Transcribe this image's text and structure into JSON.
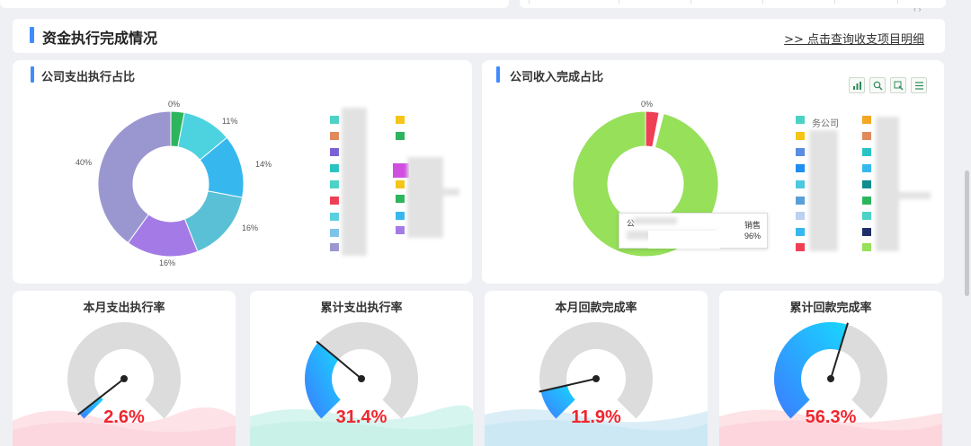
{
  "section": {
    "title": "资金执行完成情况",
    "detail_link": ">> 点击查询收支项目明细"
  },
  "scroll_hint": "‹ ›",
  "expense_card": {
    "title": "公司支出执行占比",
    "slice_labels": [
      "0%",
      "11%",
      "14%",
      "16%",
      "16%",
      "40%"
    ]
  },
  "income_card": {
    "title": "公司收入完成占比",
    "slice_labels": [
      "0%"
    ],
    "legend_partial": "务公司",
    "tooltip": {
      "left_label": "公",
      "right_label": "销售",
      "value": "96%"
    },
    "toolbox": [
      "bar-chart-icon",
      "zoom-icon",
      "restore-icon",
      "data-view-icon"
    ]
  },
  "gauges": [
    {
      "title": "本月支出执行率",
      "value": "2.6%"
    },
    {
      "title": "累计支出执行率",
      "value": "31.4%"
    },
    {
      "title": "本月回款完成率",
      "value": "11.9%"
    },
    {
      "title": "累计回款完成率",
      "value": "56.3%"
    }
  ],
  "chart_data": [
    {
      "type": "pie",
      "title": "公司支出执行占比",
      "labels": [
        "0%",
        "11%",
        "14%",
        "16%",
        "16%",
        "40%"
      ],
      "values": [
        3,
        11,
        14,
        16,
        16,
        40
      ],
      "colors": [
        "#2db55d",
        "#4dd2e0",
        "#36b8ee",
        "#5ac0d6",
        "#a47be6",
        "#9a97d0"
      ]
    },
    {
      "type": "pie",
      "title": "公司收入完成占比",
      "labels": [
        "0%",
        "",
        "96%"
      ],
      "values": [
        3,
        1,
        96
      ],
      "colors": [
        "#ee3f55",
        "#ffffff",
        "#96e05a"
      ]
    },
    {
      "type": "gauge",
      "values": [
        2.6,
        31.4,
        11.9,
        56.3
      ],
      "unit": "%"
    }
  ]
}
